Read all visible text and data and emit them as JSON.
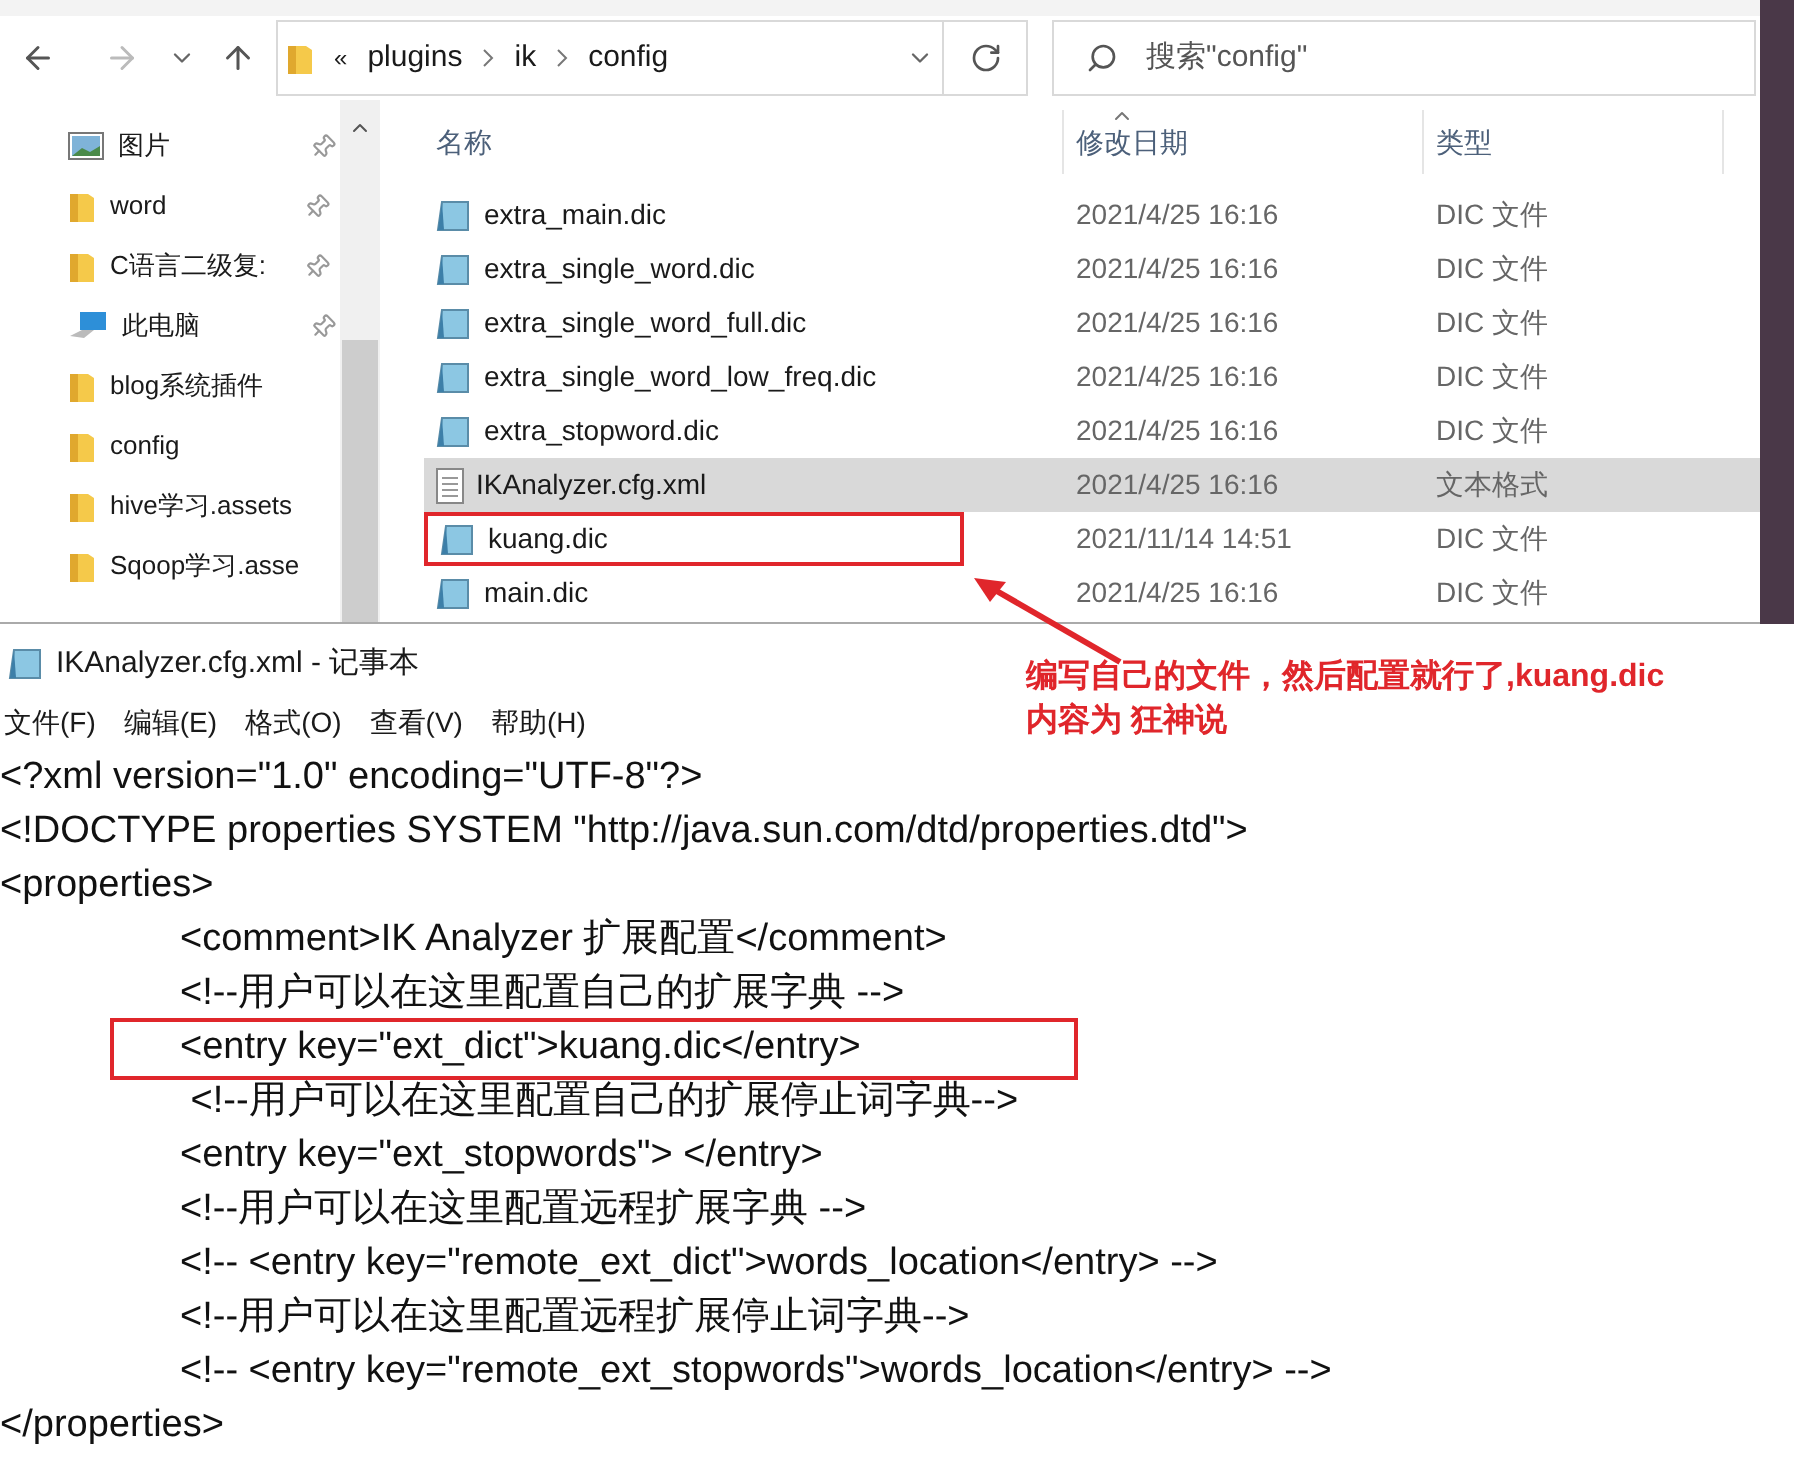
{
  "explorer": {
    "address": {
      "overflow": "«",
      "crumbs": [
        "plugins",
        "ik",
        "config"
      ]
    },
    "search": {
      "placeholder": "搜索\"config\""
    },
    "nav_items": [
      {
        "label": "图片",
        "kind": "picture",
        "pinned": true
      },
      {
        "label": "word",
        "kind": "folder",
        "pinned": true
      },
      {
        "label": "C语言二级复:",
        "kind": "folder",
        "pinned": true
      },
      {
        "label": "此电脑",
        "kind": "computer",
        "pinned": true
      },
      {
        "label": "blog系统插件",
        "kind": "folder",
        "pinned": false
      },
      {
        "label": "config",
        "kind": "folder",
        "pinned": false
      },
      {
        "label": "hive学习.assets",
        "kind": "folder",
        "pinned": false
      },
      {
        "label": "Sqoop学习.asse",
        "kind": "folder",
        "pinned": false
      }
    ],
    "columns": [
      "名称",
      "修改日期",
      "类型"
    ],
    "files": [
      {
        "name": "extra_main.dic",
        "date": "2021/4/25 16:16",
        "type": "DIC 文件",
        "kind": "dic",
        "selected": false,
        "highlighted": false
      },
      {
        "name": "extra_single_word.dic",
        "date": "2021/4/25 16:16",
        "type": "DIC 文件",
        "kind": "dic",
        "selected": false,
        "highlighted": false
      },
      {
        "name": "extra_single_word_full.dic",
        "date": "2021/4/25 16:16",
        "type": "DIC 文件",
        "kind": "dic",
        "selected": false,
        "highlighted": false
      },
      {
        "name": "extra_single_word_low_freq.dic",
        "date": "2021/4/25 16:16",
        "type": "DIC 文件",
        "kind": "dic",
        "selected": false,
        "highlighted": false
      },
      {
        "name": "extra_stopword.dic",
        "date": "2021/4/25 16:16",
        "type": "DIC 文件",
        "kind": "dic",
        "selected": false,
        "highlighted": false
      },
      {
        "name": "IKAnalyzer.cfg.xml",
        "date": "2021/4/25 16:16",
        "type": "文本格式",
        "kind": "text",
        "selected": true,
        "highlighted": false
      },
      {
        "name": "kuang.dic",
        "date": "2021/11/14 14:51",
        "type": "DIC 文件",
        "kind": "dic",
        "selected": false,
        "highlighted": true
      },
      {
        "name": "main.dic",
        "date": "2021/4/25 16:16",
        "type": "DIC 文件",
        "kind": "dic",
        "selected": false,
        "highlighted": false
      }
    ]
  },
  "annotation": [
    "编写自己的文件，然后配置就行了,kuang.dic",
    "内容为 狂神说"
  ],
  "notepad": {
    "title": "IKAnalyzer.cfg.xml - 记事本",
    "menu": [
      "文件(F)",
      "编辑(E)",
      "格式(O)",
      "查看(V)",
      "帮助(H)"
    ],
    "lines": [
      {
        "text": "<?xml version=\"1.0\" encoding=\"UTF-8\"?>",
        "highlighted": false
      },
      {
        "text": "<!DOCTYPE properties SYSTEM \"http://java.sun.com/dtd/properties.dtd\">",
        "highlighted": false
      },
      {
        "text": "<properties>",
        "highlighted": false,
        "children": [
          {
            "text": "<comment>IK Analyzer 扩展配置</comment>",
            "highlighted": false
          },
          {
            "text": "<!--用户可以在这里配置自己的扩展字典 -->",
            "highlighted": false
          },
          {
            "text": "<entry key=\"ext_dict\">kuang.dic</entry>",
            "highlighted": true
          },
          {
            "text": " <!--用户可以在这里配置自己的扩展停止词字典-->",
            "highlighted": false
          },
          {
            "text": "<entry key=\"ext_stopwords\"> </entry>",
            "highlighted": false
          },
          {
            "text": "<!--用户可以在这里配置远程扩展字典 -->",
            "highlighted": false
          },
          {
            "text": "<!-- <entry key=\"remote_ext_dict\">words_location</entry> -->",
            "highlighted": false
          },
          {
            "text": "<!--用户可以在这里配置远程扩展停止词字典-->",
            "highlighted": false
          },
          {
            "text": "<!-- <entry key=\"remote_ext_stopwords\">words_location</entry> -->",
            "highlighted": false
          }
        ]
      },
      {
        "text": "</properties>",
        "highlighted": false
      }
    ]
  }
}
